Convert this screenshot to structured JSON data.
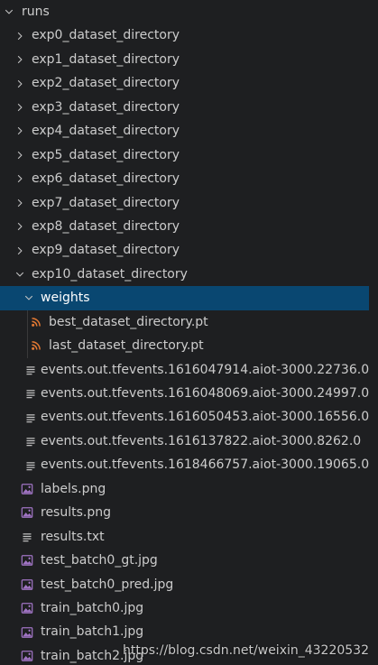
{
  "explorer": {
    "root": {
      "label": "runs",
      "expanded": true
    },
    "experiments": [
      {
        "label": "exp0_dataset_directory"
      },
      {
        "label": "exp1_dataset_directory"
      },
      {
        "label": "exp2_dataset_directory"
      },
      {
        "label": "exp3_dataset_directory"
      },
      {
        "label": "exp4_dataset_directory"
      },
      {
        "label": "exp5_dataset_directory"
      },
      {
        "label": "exp6_dataset_directory"
      },
      {
        "label": "exp7_dataset_directory"
      },
      {
        "label": "exp8_dataset_directory"
      },
      {
        "label": "exp9_dataset_directory"
      }
    ],
    "expanded_experiment": {
      "label": "exp10_dataset_directory"
    },
    "weights_folder": {
      "label": "weights",
      "selected": true
    },
    "weights_files": [
      {
        "label": "best_dataset_directory.pt",
        "icon": "rss-icon"
      },
      {
        "label": "last_dataset_directory.pt",
        "icon": "rss-icon"
      }
    ],
    "event_files": [
      {
        "label": "events.out.tfevents.1616047914.aiot-3000.22736.0"
      },
      {
        "label": "events.out.tfevents.1616048069.aiot-3000.24997.0"
      },
      {
        "label": "events.out.tfevents.1616050453.aiot-3000.16556.0"
      },
      {
        "label": "events.out.tfevents.1616137822.aiot-3000.8262.0"
      },
      {
        "label": "events.out.tfevents.1618466757.aiot-3000.19065.0"
      }
    ],
    "other_files": [
      {
        "label": "labels.png",
        "icon": "image-icon"
      },
      {
        "label": "results.png",
        "icon": "image-icon"
      },
      {
        "label": "results.txt",
        "icon": "text-file-icon"
      },
      {
        "label": "test_batch0_gt.jpg",
        "icon": "image-icon"
      },
      {
        "label": "test_batch0_pred.jpg",
        "icon": "image-icon"
      },
      {
        "label": "train_batch0.jpg",
        "icon": "image-icon"
      },
      {
        "label": "train_batch1.jpg",
        "icon": "image-icon"
      },
      {
        "label": "train_batch2.jpg",
        "icon": "image-icon"
      }
    ]
  },
  "colors": {
    "background": "#1e1f21",
    "selection": "#094771",
    "rss_orange": "#e37933",
    "image_purple": "#a074c4"
  },
  "watermark": "https://blog.csdn.net/weixin_43220532"
}
